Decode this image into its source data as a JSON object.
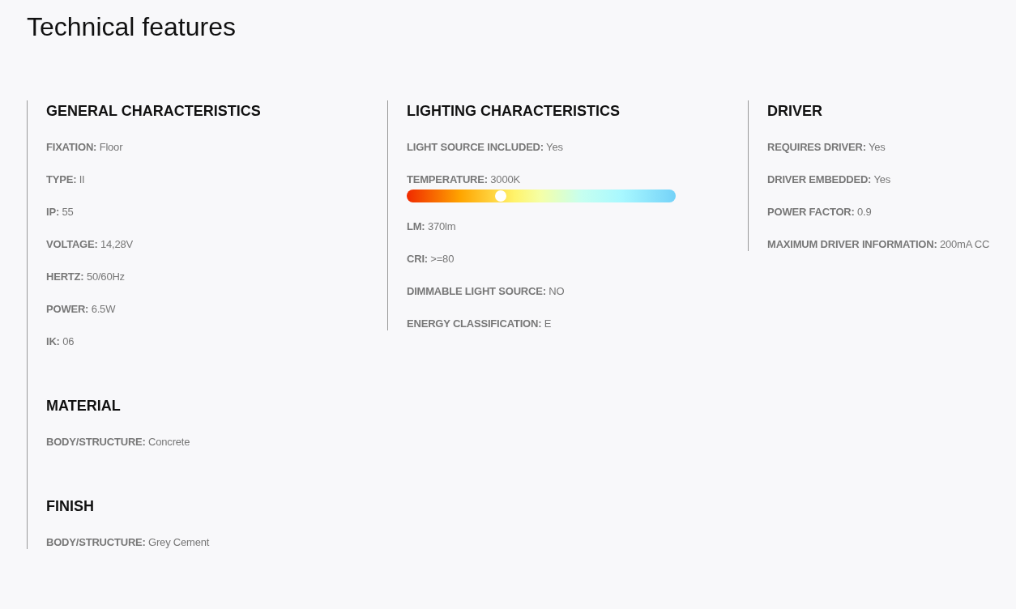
{
  "title": "Technical features",
  "columns": [
    {
      "sections": [
        {
          "heading": "GENERAL CHARACTERISTICS",
          "items": [
            {
              "kind": "text",
              "text": "**FIXATION:** Floor"
            },
            {
              "kind": "text",
              "text": "**TYPE:** II"
            },
            {
              "kind": "text",
              "text": "**IP:** 55"
            },
            {
              "kind": "text",
              "text": "**VOLTAGE:** 14,28V"
            },
            {
              "kind": "text",
              "text": "**HERTZ:** 50/60Hz"
            },
            {
              "kind": "text",
              "text": "**POWER:** 6.5W"
            },
            {
              "kind": "text",
              "text": "**IK:** 06"
            }
          ]
        },
        {
          "heading": "MATERIAL",
          "items": [
            {
              "kind": "text",
              "text": "**BODY/STRUCTURE:** Concrete"
            }
          ]
        },
        {
          "heading": "FINISH",
          "items": [
            {
              "kind": "text",
              "text": "**BODY/STRUCTURE:** Grey Cement"
            }
          ]
        }
      ]
    },
    {
      "sections": [
        {
          "heading": "LIGHTING CHARACTERISTICS",
          "items": [
            {
              "kind": "text",
              "text": "**LIGHT SOURCE INCLUDED:** Yes"
            },
            {
              "kind": "scale",
              "text": "**TEMPERATURE:** 3000K",
              "level": 0.35
            },
            {
              "kind": "text",
              "text": "**LM:** 370lm"
            },
            {
              "kind": "text",
              "text": "**CRI:** >=80"
            },
            {
              "kind": "text",
              "text": "**DIMMABLE LIGHT SOURCE:** NO"
            },
            {
              "kind": "text",
              "text": "**ENERGY CLASSIFICATION:** E"
            }
          ]
        }
      ]
    },
    {
      "sections": [
        {
          "heading": "DRIVER",
          "items": [
            {
              "kind": "text",
              "text": "**REQUIRES DRIVER:** Yes"
            },
            {
              "kind": "text",
              "text": "**DRIVER EMBEDDED:** Yes"
            },
            {
              "kind": "text",
              "text": "**POWER FACTOR:** 0.9"
            },
            {
              "kind": "text",
              "text": "**MAXIMUM DRIVER INFORMATION:** 200mA CC"
            }
          ]
        }
      ]
    }
  ]
}
